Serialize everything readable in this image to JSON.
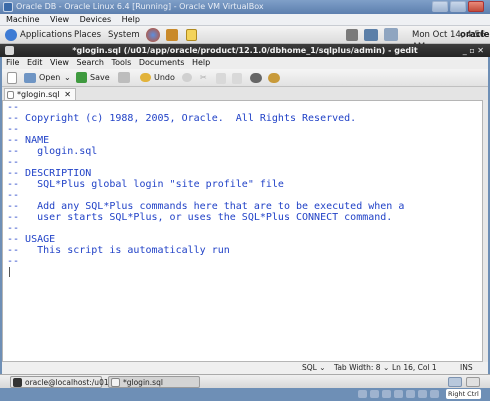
{
  "vbox": {
    "title": "Oracle DB - Oracle Linux 6.4 [Running] - Oracle VM VirtualBox",
    "menu": [
      "Machine",
      "View",
      "Devices",
      "Help"
    ],
    "host_key": "Right Ctrl"
  },
  "panel": {
    "applications": "Applications",
    "places": "Places",
    "system": "System",
    "datetime": "Mon Oct 14,  4:56 AM",
    "user": "oracle"
  },
  "gedit": {
    "title": "*glogin.sql (/u01/app/oracle/product/12.1.0/dbhome_1/sqlplus/admin) - gedit",
    "menu": [
      "File",
      "Edit",
      "View",
      "Search",
      "Tools",
      "Documents",
      "Help"
    ],
    "toolbar": {
      "open": "Open",
      "save": "Save",
      "undo": "Undo"
    },
    "tab_label": "*glogin.sql",
    "file_lines": [
      "--",
      "-- Copyright (c) 1988, 2005, Oracle.  All Rights Reserved.",
      "--",
      "-- NAME",
      "--   glogin.sql",
      "--",
      "-- DESCRIPTION",
      "--   SQL*Plus global login \"site profile\" file",
      "--",
      "--   Add any SQL*Plus commands here that are to be executed when a",
      "--   user starts SQL*Plus, or uses the SQL*Plus CONNECT command.",
      "--",
      "-- USAGE",
      "--   This script is automatically run",
      "--"
    ],
    "status": {
      "language": "SQL",
      "tab_width": "Tab Width: 8",
      "position": "Ln 16, Col 1",
      "mode": "INS"
    }
  },
  "taskbar": {
    "items": [
      "oracle@localhost:/u01...",
      "*glogin.sql (/u01/app/..."
    ]
  },
  "colors": {
    "code": "#2142c7",
    "titlebar": "#2a2a2a"
  }
}
